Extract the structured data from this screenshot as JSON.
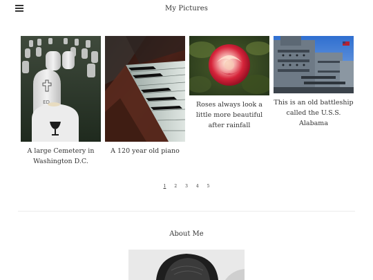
{
  "header": {
    "menu_icon": "hamburger-menu-icon",
    "title": "My Pictures"
  },
  "gallery": {
    "items": [
      {
        "caption": "A large Cemetery in Washington D.C.",
        "image": "cemetery-photo"
      },
      {
        "caption": "A 120 year old piano",
        "image": "piano-keys-photo"
      },
      {
        "caption": "Roses always look a little more beautiful after rainfall",
        "image": "rose-photo"
      },
      {
        "caption": "This is an old battleship called the U.S.S. Alabama",
        "image": "battleship-photo"
      }
    ]
  },
  "pagination": {
    "pages": [
      "1",
      "2",
      "3",
      "4",
      "5"
    ],
    "current": "1"
  },
  "about": {
    "title": "About Me"
  }
}
